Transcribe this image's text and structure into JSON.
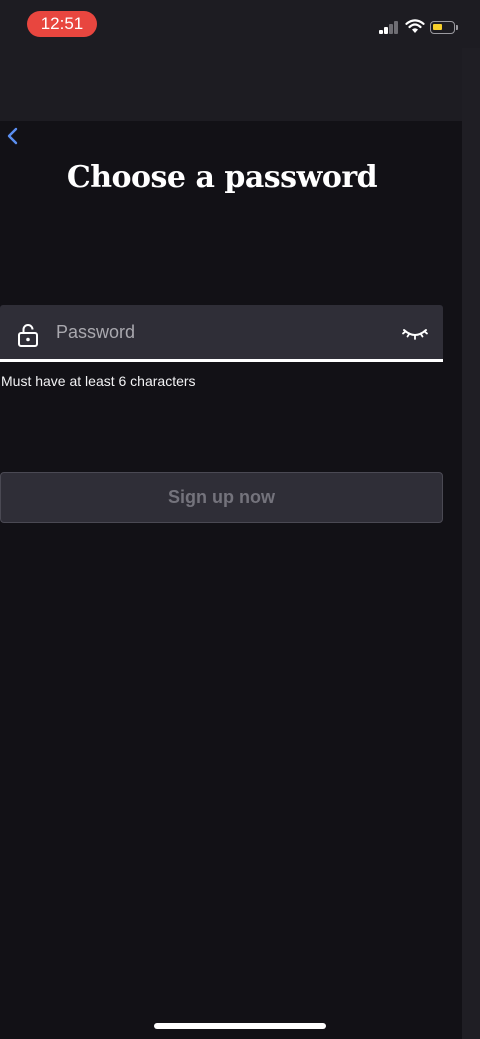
{
  "status_bar": {
    "time": "12:51",
    "battery_color": "#f6cf2b",
    "time_pill_color": "#e8463f"
  },
  "nav": {
    "back_icon": "chevron-left-icon"
  },
  "page": {
    "title": "Choose a password",
    "password_field": {
      "placeholder": "Password",
      "value": "",
      "lock_icon": "lock-icon",
      "toggle_icon": "eye-closed-icon"
    },
    "hint": "Must have at least 6 characters",
    "signup_button_label": "Sign up now"
  },
  "colors": {
    "background": "#121116",
    "field": "#2f2e37",
    "accent_back": "#5b8ef0"
  }
}
